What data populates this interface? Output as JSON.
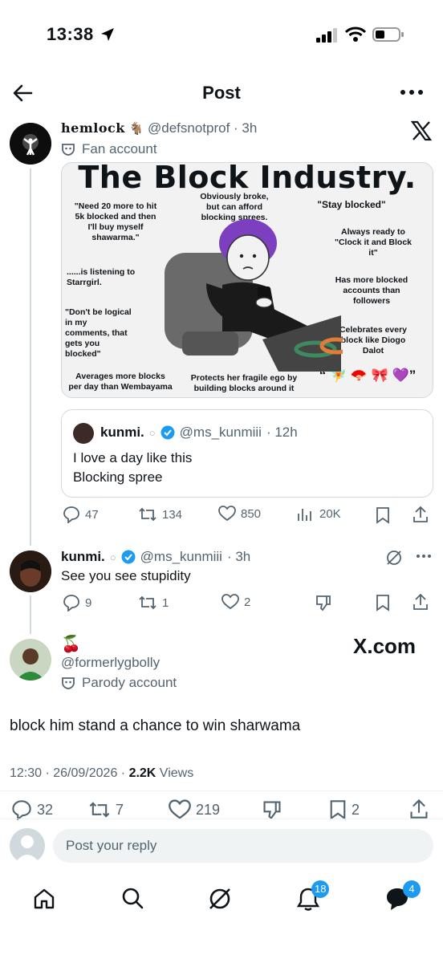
{
  "status": {
    "time": "13:38"
  },
  "header": {
    "title": "Post"
  },
  "post1": {
    "display_name": "hemlock",
    "handle": "@defsnotprof",
    "time": "· 3h",
    "label": "Fan account",
    "meme": {
      "title": "The Block Industry.",
      "labels": {
        "need20": "\"Need 20 more to hit 5k blocked and then I'll buy myself shawarma.\"",
        "broke": "Obviously broke, but can afford blocking sprees.",
        "stay": "\"Stay blocked\"",
        "clock": "Always ready to \"Clock it and Block it\"",
        "starrgirl": "......is listening to Starrgirl.",
        "more_blocked": "Has more blocked accounts than followers",
        "logical": "\"Don't be logical in my comments, that gets you blocked\"",
        "celebrates": "Celebrates every block like Diogo Dalot",
        "averages": "Averages more blocks per day than Wembayama",
        "protects": "Protects her fragile ego by building blocks around it"
      },
      "emojis": "“ 🧚 🪭 🎀 💜”"
    },
    "quote": {
      "name": "kunmi.",
      "handle": "@ms_kunmiii",
      "time": "· 12h",
      "line1": "I love a day like this",
      "line2": "Blocking spree"
    },
    "stats": {
      "replies": "47",
      "reposts": "134",
      "likes": "850",
      "views": "20K"
    }
  },
  "post2": {
    "name": "kunmi.",
    "handle": "@ms_kunmiii",
    "time": "· 3h",
    "text": "See you see stupidity",
    "stats": {
      "replies": "9",
      "reposts": "1",
      "likes": "2"
    }
  },
  "main": {
    "emoji_name": "🍒",
    "handle": "@formerlygbolly",
    "label": "Parody account",
    "watermark": "X.com",
    "text": "block him stand a chance to win sharwama",
    "meta": {
      "time": "12:30 · 26/09/2026 · ",
      "views_count": "2.2K",
      "views_label": " Views"
    },
    "stats": {
      "replies": "32",
      "reposts": "7",
      "likes": "219",
      "bookmarks": "2"
    }
  },
  "reply": {
    "placeholder": "Post your reply"
  },
  "tabbar": {
    "notifications_badge": "18",
    "messages_badge": "4"
  },
  "colors": {
    "accent": "#1d9bf0",
    "text": "#0f1419",
    "muted": "#536471"
  }
}
